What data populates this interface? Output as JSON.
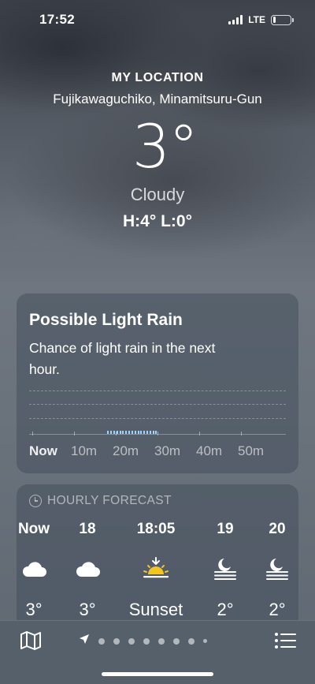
{
  "status_bar": {
    "time": "17:52",
    "network": "LTE",
    "battery_level": 0.15
  },
  "location": {
    "title": "MY LOCATION",
    "place": "Fujikawaguchiko, Minamitsuru-Gun",
    "temperature": "3°",
    "condition": "Cloudy",
    "hi_lo": "H:4°  L:0°"
  },
  "rain_card": {
    "title": "Possible Light Rain",
    "description": "Chance of light rain in the next hour.",
    "ticks": [
      "Now",
      "10m",
      "20m",
      "30m",
      "40m",
      "50m"
    ],
    "rain_minutes": [
      18,
      30
    ],
    "rain_color": "#9dd3ff"
  },
  "hourly": {
    "header": "HOURLY FORECAST",
    "items": [
      {
        "time": "Now",
        "icon": "cloud-icon",
        "temp": "3°"
      },
      {
        "time": "18",
        "icon": "cloud-icon",
        "temp": "3°"
      },
      {
        "time": "18:05",
        "icon": "sunset-icon",
        "temp": "Sunset"
      },
      {
        "time": "19",
        "icon": "moon-fog-icon",
        "temp": "2°"
      },
      {
        "time": "20",
        "icon": "moon-fog-icon",
        "temp": "2°"
      }
    ],
    "sunset_color": "#f5c518"
  },
  "bottom_bar": {
    "map_icon": "map-icon",
    "location_icon": "location-arrow-icon",
    "page_count": 8,
    "list_icon": "list-icon"
  }
}
